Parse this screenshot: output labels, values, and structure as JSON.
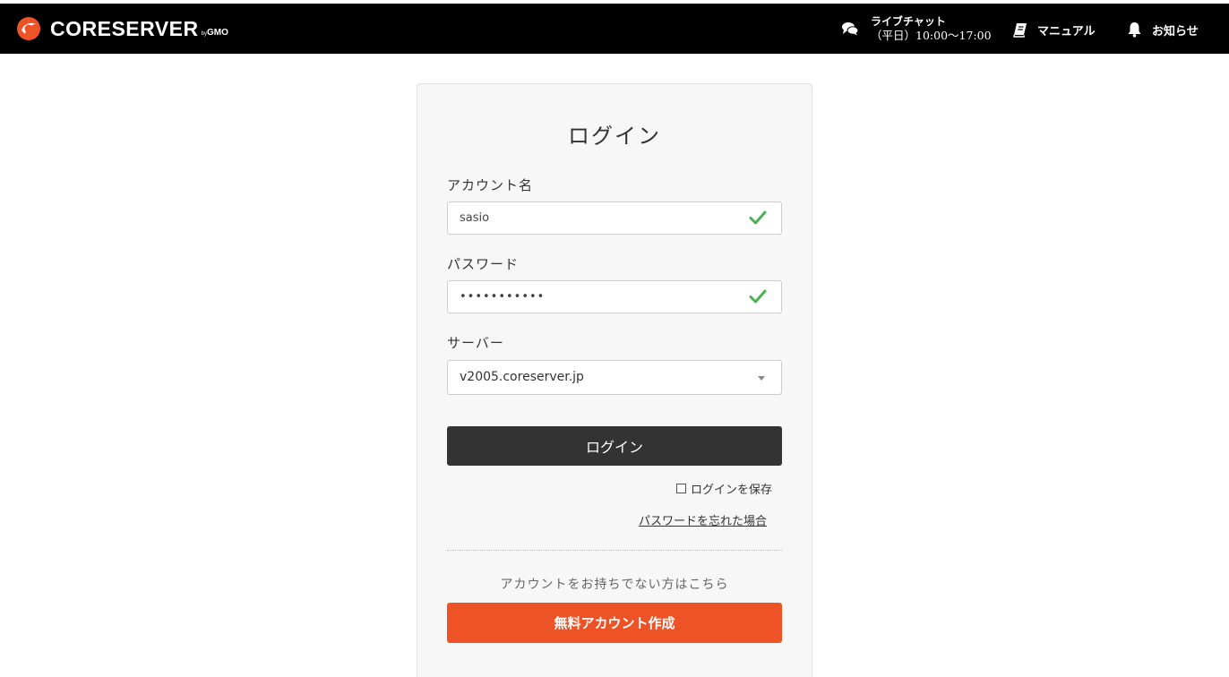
{
  "colors": {
    "header_bg": "#000000",
    "brand_orange": "#ed5326",
    "login_button": "#333333",
    "check_green": "#4caf50"
  },
  "header": {
    "logo_text": "CORESERVER",
    "logo_suffix_by": "by",
    "logo_suffix_brand": "GMO",
    "chat": {
      "icon": "chat-bubbles-icon",
      "label": "ライブチャット",
      "hours": "（平日）10:00〜17:00"
    },
    "manual": {
      "icon": "book-icon",
      "label": "マニュアル"
    },
    "news": {
      "icon": "bell-icon",
      "label": "お知らせ"
    }
  },
  "login": {
    "title": "ログイン",
    "account_label": "アカウント名",
    "account_value": "sasio",
    "password_label": "パスワード",
    "password_value": "•••••••••••",
    "server_label": "サーバー",
    "server_value": "v2005.coreserver.jp",
    "submit_label": "ログイン",
    "remember_label": "ログインを保存",
    "forgot_label": "パスワードを忘れた場合",
    "no_account_text": "アカウントをお持ちでない方はこちら",
    "signup_label": "無料アカウント作成"
  }
}
